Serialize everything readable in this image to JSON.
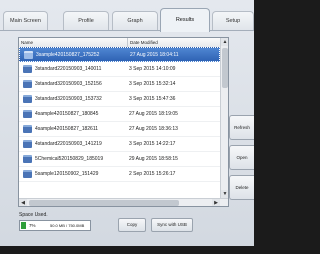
{
  "tabs": [
    {
      "label": "Main Screen"
    },
    {
      "label": "Profile"
    },
    {
      "label": "Graph"
    },
    {
      "label": "Results",
      "active": true
    },
    {
      "label": "Setup"
    }
  ],
  "file_list": {
    "columns": {
      "name": "Name",
      "date_modified": "Date Modified"
    },
    "rows": [
      {
        "name": "3sample420150827_175252",
        "date": "27 Aug 2015 18:04:11",
        "selected": true
      },
      {
        "name": "3standard220150903_140011",
        "date": "3 Sep 2015 14:10:09"
      },
      {
        "name": "3standard320150903_152156",
        "date": "3 Sep 2015 15:32:14"
      },
      {
        "name": "3standard320150903_153732",
        "date": "3 Sep 2015 15:47:36"
      },
      {
        "name": "4sample420150827_180845",
        "date": "27 Aug 2015 18:19:05"
      },
      {
        "name": "4sample420150827_182611",
        "date": "27 Aug 2015 18:36:13"
      },
      {
        "name": "4standard220150903_141219",
        "date": "3 Sep 2015 14:22:17"
      },
      {
        "name": "5Chemical520150829_185019",
        "date": "29 Aug 2015 18:58:15"
      },
      {
        "name": "5sample120150902_151429",
        "date": "2 Sep 2015 15:26:17"
      }
    ],
    "scroll_up_icon": "arrow-up-icon",
    "scroll_down_icon": "arrow-down-icon",
    "scroll_left_icon": "arrow-left-icon",
    "scroll_right_icon": "arrow-right-icon"
  },
  "side_buttons": {
    "refresh": "Refresh",
    "open": "Open",
    "delete": "Delete"
  },
  "storage": {
    "label": "Space Used.",
    "percent": "7%",
    "percent_value": 0.07,
    "amount": "50.0 MB / 750.0MB",
    "bar_color": "#2f9e3a"
  },
  "bottom_buttons": {
    "copy": "Copy",
    "sync": "Sync with USB"
  },
  "colors": {
    "selection": "#3a6fc0",
    "background": "#dde2e8"
  }
}
